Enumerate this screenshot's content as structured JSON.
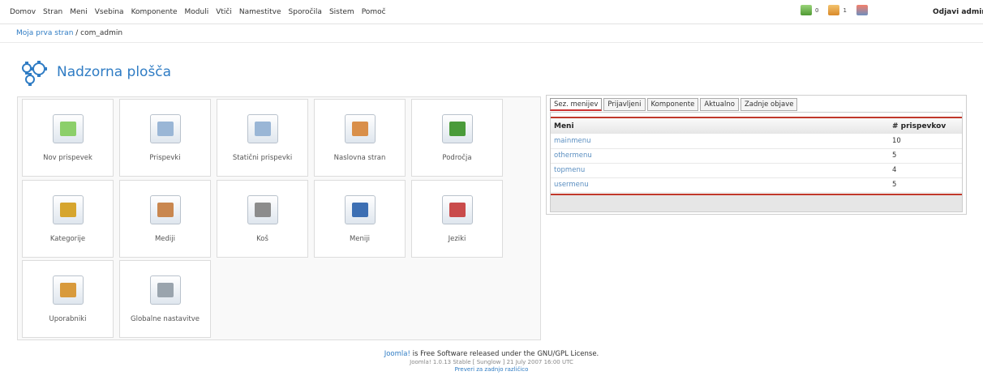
{
  "menu": [
    "Domov",
    "Stran",
    "Meni",
    "Vsebina",
    "Komponente",
    "Moduli",
    "Vtiči",
    "Namestitve",
    "Sporočila",
    "Sistem",
    "Pomoč"
  ],
  "status": {
    "messages_count": "0",
    "users_count": "1"
  },
  "logout_label": "Odjavi admin",
  "breadcrumb": {
    "link": "Moja prva stran",
    "separator": " / ",
    "current": "com_admin"
  },
  "page_title": "Nadzorna plošča",
  "tiles": [
    {
      "label": "Nov prispevek",
      "icon": "new-article-icon",
      "color": "#8ccf6a"
    },
    {
      "label": "Prispevki",
      "icon": "articles-icon",
      "color": "#9ab6d6"
    },
    {
      "label": "Statični prispevki",
      "icon": "static-articles-icon",
      "color": "#9ab6d6"
    },
    {
      "label": "Naslovna stran",
      "icon": "frontpage-icon",
      "color": "#d98f4a"
    },
    {
      "label": "Področja",
      "icon": "sections-icon",
      "color": "#4a9b3a"
    },
    {
      "label": "Kategorije",
      "icon": "categories-icon",
      "color": "#d6a52e"
    },
    {
      "label": "Mediji",
      "icon": "media-icon",
      "color": "#c9874f"
    },
    {
      "label": "Koš",
      "icon": "trash-icon",
      "color": "#8c8c8c"
    },
    {
      "label": "Meniji",
      "icon": "menus-icon",
      "color": "#3d6fb3"
    },
    {
      "label": "Jeziki",
      "icon": "languages-icon",
      "color": "#c94b4b"
    },
    {
      "label": "Uporabniki",
      "icon": "users-icon",
      "color": "#d89a3c"
    },
    {
      "label": "Globalne nastavitve",
      "icon": "global-config-icon",
      "color": "#9aa4ad"
    }
  ],
  "tabs": [
    "Sez. menijev",
    "Prijavljeni",
    "Komponente",
    "Aktualno",
    "Zadnje objave"
  ],
  "menu_table": {
    "headers": [
      "Meni",
      "# prispevkov"
    ],
    "rows": [
      {
        "name": "mainmenu",
        "count": "10"
      },
      {
        "name": "othermenu",
        "count": "5"
      },
      {
        "name": "topmenu",
        "count": "4"
      },
      {
        "name": "usermenu",
        "count": "5"
      }
    ]
  },
  "footer": {
    "link": "Joomla!",
    "text": " is Free Software released under the GNU/GPL License.",
    "version": "Joomla! 1.0.13 Stable [ Sunglow ] 21 July 2007 16:00 UTC",
    "check": "Preveri za zadnjo različico"
  },
  "colors": {
    "accent": "#2f7cc4",
    "tab_border": "#c0392b"
  }
}
